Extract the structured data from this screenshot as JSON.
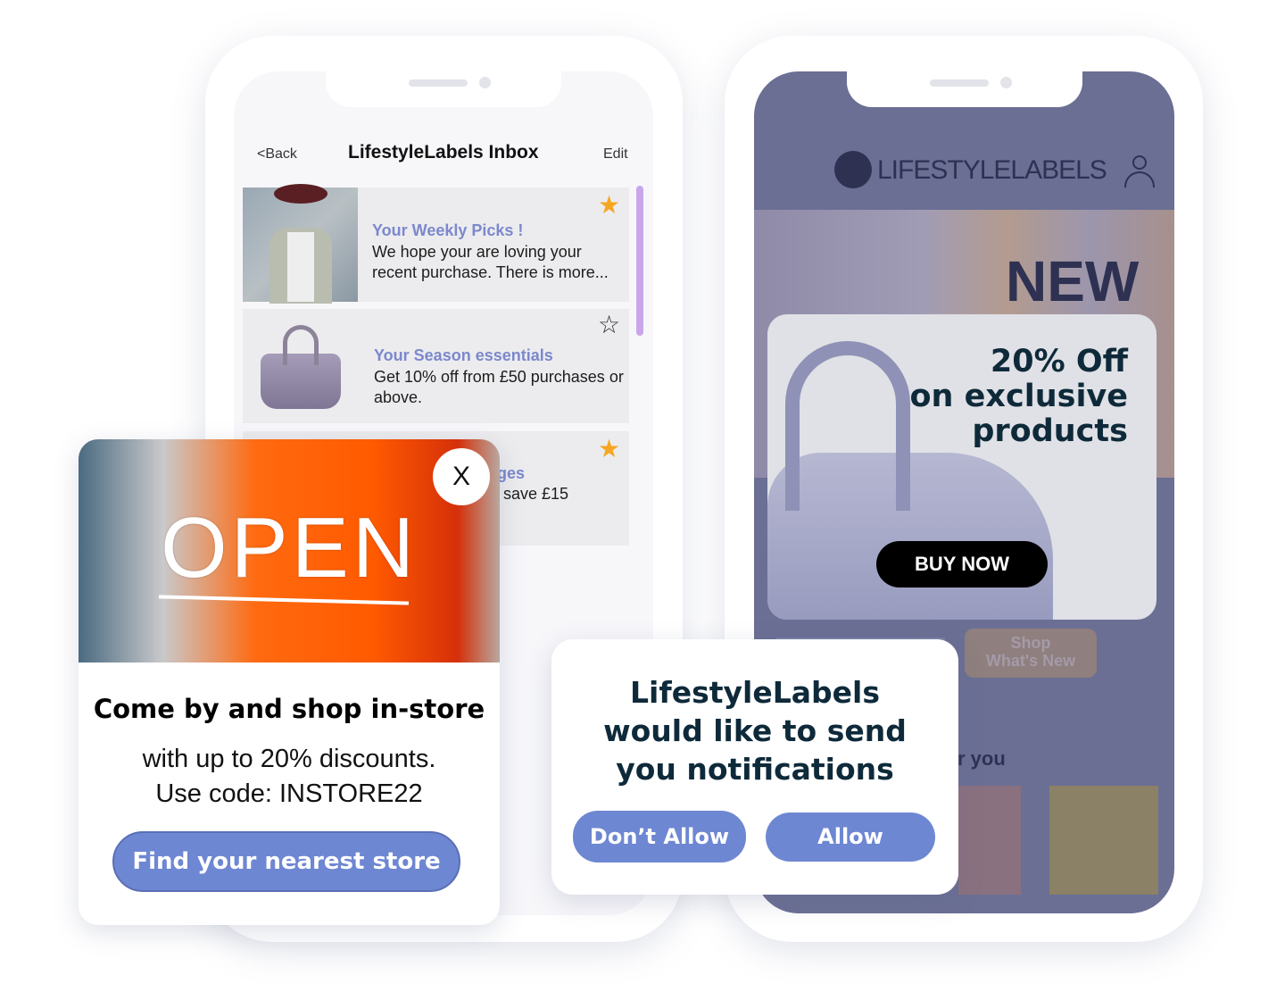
{
  "inbox": {
    "back_label": "<Back",
    "title": "LifestyleLabels Inbox",
    "edit_label": "Edit",
    "messages": [
      {
        "title": "Your Weekly Picks !",
        "body": "We hope your are loving your recent purchase. There is more...",
        "starred": true
      },
      {
        "title": "Your Season essentials",
        "body": "Get 10% off from £50 purchases or above.",
        "starred": false
      },
      {
        "title": "ges",
        "body": "save £15",
        "starred": true
      }
    ],
    "star_color": "#f5a623",
    "scrollbar_color": "#c9a6ea"
  },
  "store_popup": {
    "image_text": "OPEN",
    "close_label": "X",
    "heading": "Come by and shop in-store",
    "line1": "with up to 20% discounts.",
    "line2": "Use code: INSTORE22",
    "button_label": "Find your nearest store"
  },
  "shop_app": {
    "logo_text": "LIFESTYLELABELS",
    "banner_text": "NEW",
    "promo": {
      "line1": "20% Off",
      "line2": "on exclusive",
      "line3": "products",
      "button_label": "BUY NOW"
    },
    "shop_button_line1": "Shop",
    "shop_button_line2": "What's New",
    "section_partial": "r you"
  },
  "notification_dialog": {
    "line1": "LifestyleLabels",
    "line2": "would like to send",
    "line3": "you notifications",
    "deny_label": "Don’t Allow",
    "allow_label": "Allow"
  },
  "colors": {
    "accent": "#6e87d2",
    "overlay": "#6b6f94",
    "dark_text": "#0e2a3a"
  }
}
